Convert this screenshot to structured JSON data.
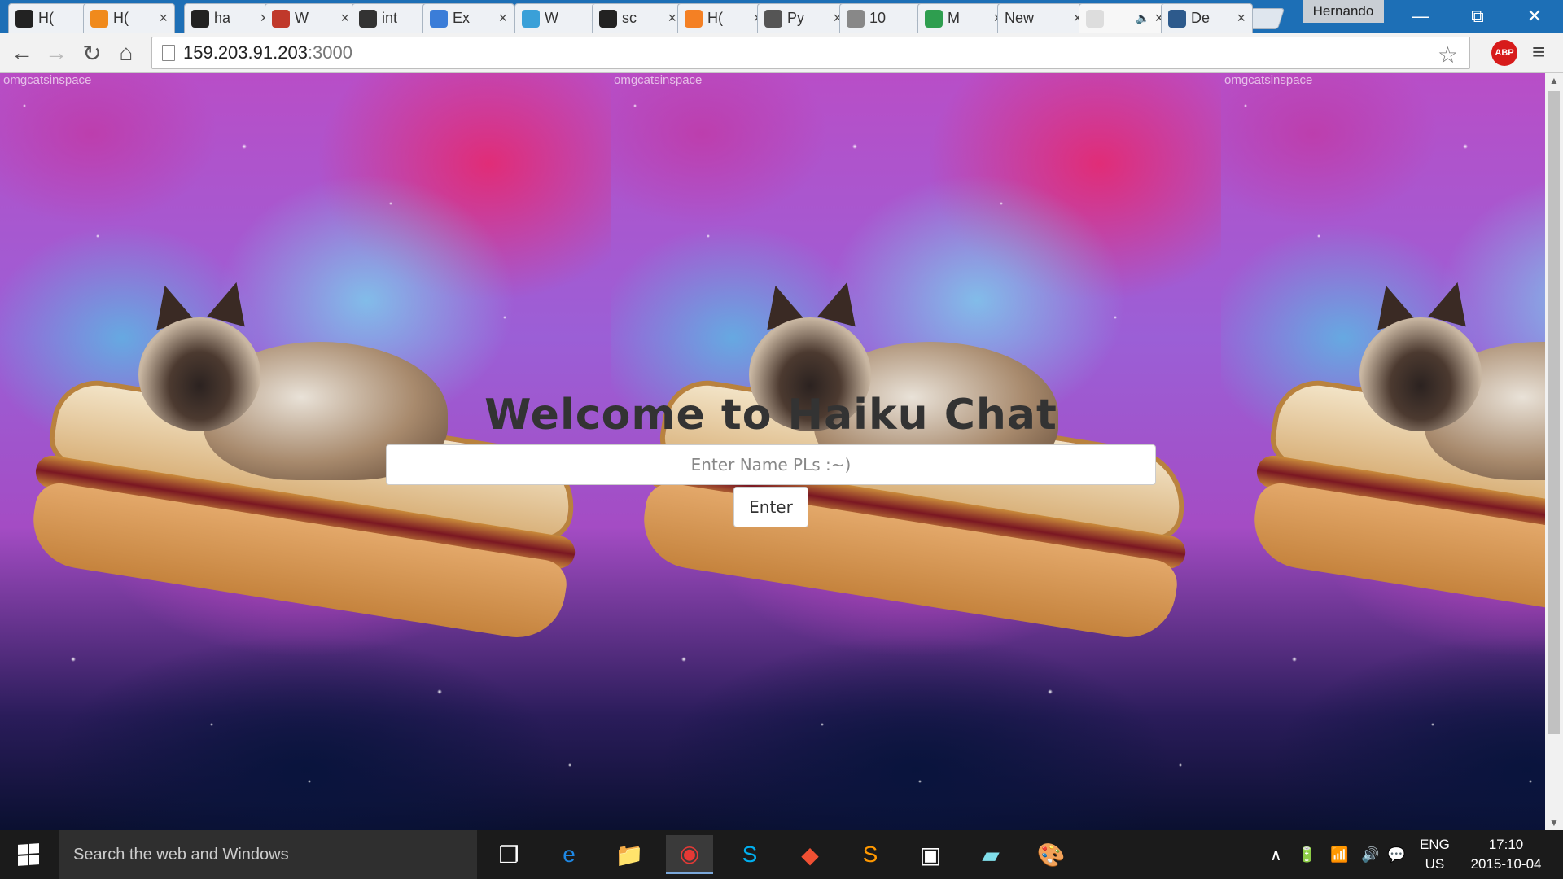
{
  "browser": {
    "tabs": [
      {
        "title": "H(",
        "favicon": "github-icon",
        "color": "#222222",
        "active": false
      },
      {
        "title": "H(",
        "favicon": "flower-icon",
        "color": "#f08a1c",
        "active": false
      },
      {
        "title": "ha",
        "favicon": "github-icon",
        "color": "#222222",
        "active": false
      },
      {
        "title": "W",
        "favicon": "photo-icon",
        "color": "#c0392b",
        "active": false
      },
      {
        "title": "int",
        "favicon": "dark-square-icon",
        "color": "#333333",
        "active": false
      },
      {
        "title": "Ex",
        "favicon": "letter-d-icon",
        "color": "#3b7dd8",
        "active": false
      },
      {
        "title": "W",
        "favicon": "snowflake-icon",
        "color": "#3aa0d8",
        "active": false
      },
      {
        "title": "sc",
        "favicon": "github-icon",
        "color": "#222222",
        "active": false
      },
      {
        "title": "H(",
        "favicon": "stack-icon",
        "color": "#f48024",
        "active": false
      },
      {
        "title": "Py",
        "favicon": "diamond-icon",
        "color": "#555555",
        "active": false
      },
      {
        "title": "10",
        "favicon": "gear-icon",
        "color": "#888888",
        "active": false
      },
      {
        "title": "M",
        "favicon": "drive-icon",
        "color": "#2e9e4f",
        "active": false
      },
      {
        "title": "New",
        "favicon": "",
        "color": "#eef1f5",
        "active": false
      },
      {
        "title": "",
        "favicon": "page-icon",
        "color": "#dddddd",
        "active": true,
        "audio": "🔈"
      },
      {
        "title": "De",
        "favicon": "letter-d-circle-icon",
        "color": "#2d5a8c",
        "active": false
      }
    ],
    "profile_name": "Hernando",
    "close_glyph": "×",
    "window_controls": {
      "minimize": "—",
      "restore": "⧉",
      "close": "✕"
    },
    "nav": {
      "back": "←",
      "forward": "→",
      "reload": "↻",
      "home": "⌂"
    },
    "url_host": "159.203.91.203",
    "url_port": ":3000",
    "star": "☆",
    "abp_label": "ABP",
    "menu": "≡"
  },
  "page": {
    "watermark": "omgcatsinspace",
    "title": "Welcome to Haiku Chat",
    "name_placeholder": "Enter Name PLs :~)",
    "enter_label": "Enter"
  },
  "scrollbar": {
    "up": "▲",
    "down": "▼"
  },
  "taskbar": {
    "search_placeholder": "Search the web and Windows",
    "apps": [
      {
        "name": "task-view",
        "glyph": "❐"
      },
      {
        "name": "edge",
        "glyph": "e",
        "color": "#1e88e5"
      },
      {
        "name": "file-explorer",
        "glyph": "📁"
      },
      {
        "name": "chrome",
        "glyph": "◉",
        "color": "#e53935",
        "active": true
      },
      {
        "name": "skype",
        "glyph": "S",
        "color": "#00aff0"
      },
      {
        "name": "git",
        "glyph": "◆",
        "color": "#f05033"
      },
      {
        "name": "sublime",
        "glyph": "S",
        "color": "#ff9800"
      },
      {
        "name": "terminal",
        "glyph": "▣"
      },
      {
        "name": "notes",
        "glyph": "▰",
        "color": "#80deea"
      },
      {
        "name": "paint",
        "glyph": "🎨"
      }
    ],
    "tray": {
      "chevron": "∧",
      "battery": "🔋",
      "wifi": "📶",
      "volume": "🔊",
      "notifications": "💬"
    },
    "language": "ENG",
    "region": "US",
    "time": "17:10",
    "date": "2015-10-04"
  }
}
